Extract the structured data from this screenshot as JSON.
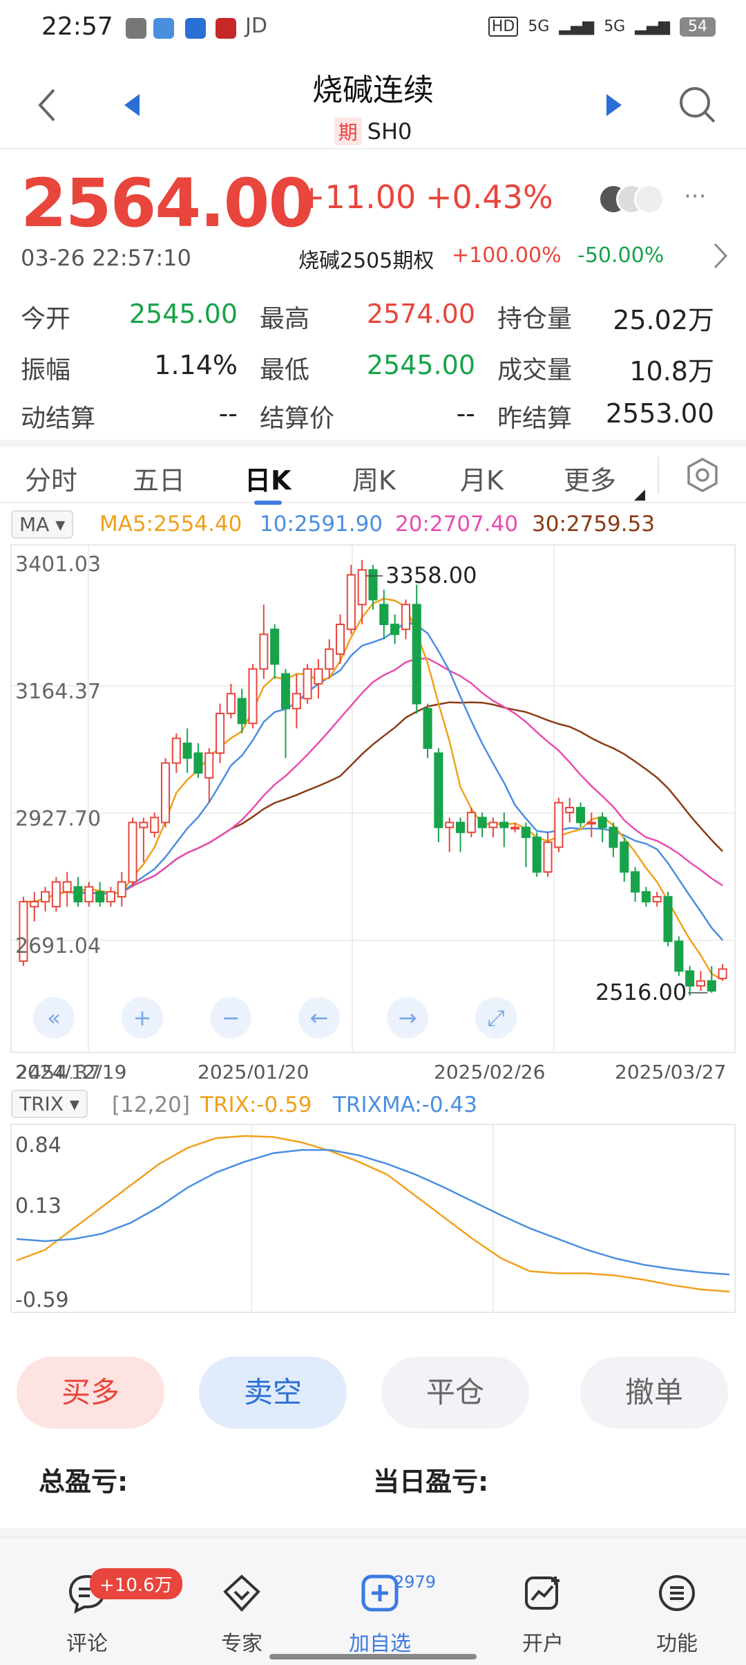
{
  "status_bar": {
    "time": "22:57",
    "carrier": "JD",
    "battery": "54",
    "net1": "5G",
    "net2": "5G",
    "hd": "HD"
  },
  "header": {
    "title": "烧碱连续",
    "badge": "期",
    "code": "SH0"
  },
  "quote": {
    "price": "2564.00",
    "change": "+11.00",
    "change_pct": "+0.43%",
    "datetime": "03-26 22:57:10",
    "option_name": "烧碱2505期权",
    "option_up": "+100.00%",
    "option_down": "-50.00%"
  },
  "stats": {
    "open_label": "今开",
    "open": "2545.00",
    "high_label": "最高",
    "high": "2574.00",
    "oi_label": "持仓量",
    "oi": "25.02万",
    "amp_label": "振幅",
    "amp": "1.14%",
    "low_label": "最低",
    "low": "2545.00",
    "vol_label": "成交量",
    "vol": "10.8万",
    "settle_dyn_label": "动结算",
    "settle_dyn": "--",
    "settle_label": "结算价",
    "settle": "--",
    "prev_settle_label": "昨结算",
    "prev_settle": "2553.00"
  },
  "tabs": [
    "分时",
    "五日",
    "日K",
    "周K",
    "月K",
    "更多"
  ],
  "ma_legend": {
    "selector": "MA",
    "ma5": "MA5:2554.40",
    "ma10": "10:2591.90",
    "ma20": "20:2707.40",
    "ma30": "30:2759.53"
  },
  "trix_legend": {
    "selector": "TRIX",
    "params": "[12,20]",
    "trix": "TRIX:-0.59",
    "trixma": "TRIXMA:-0.43"
  },
  "colors": {
    "up": "#e8453c",
    "down": "#17a34a",
    "ma5": "#f0a01c",
    "ma10": "#4a8ee0",
    "ma20": "#e84cb0",
    "ma30": "#8b3a14"
  },
  "chart_data": [
    {
      "type": "candlestick",
      "y_ticks": [
        "3401.03",
        "3164.37",
        "2927.70",
        "2691.04",
        "2454.37"
      ],
      "ylim": [
        2454.37,
        3401.03
      ],
      "x_ticks": [
        "2024/12/19",
        "2025/01/20",
        "2025/02/26",
        "2025/03/27"
      ],
      "annotations": {
        "high": "3358.00",
        "low": "2516.00"
      },
      "candles": [
        [
          2580,
          2700,
          2570,
          2710
        ],
        [
          2690,
          2700,
          2660,
          2720
        ],
        [
          2700,
          2720,
          2680,
          2730
        ],
        [
          2690,
          2740,
          2680,
          2750
        ],
        [
          2720,
          2740,
          2690,
          2760
        ],
        [
          2730,
          2700,
          2690,
          2750
        ],
        [
          2700,
          2730,
          2690,
          2740
        ],
        [
          2720,
          2700,
          2690,
          2740
        ],
        [
          2700,
          2720,
          2690,
          2730
        ],
        [
          2710,
          2740,
          2690,
          2760
        ],
        [
          2740,
          2860,
          2730,
          2870
        ],
        [
          2850,
          2860,
          2780,
          2870
        ],
        [
          2840,
          2870,
          2830,
          2880
        ],
        [
          2860,
          2980,
          2850,
          2990
        ],
        [
          2980,
          3030,
          2960,
          3040
        ],
        [
          3020,
          2990,
          2960,
          3050
        ],
        [
          3000,
          2960,
          2950,
          3020
        ],
        [
          2950,
          3000,
          2900,
          3010
        ],
        [
          3000,
          3080,
          2980,
          3100
        ],
        [
          3080,
          3120,
          3070,
          3140
        ],
        [
          3110,
          3060,
          3040,
          3130
        ],
        [
          3060,
          3170,
          3050,
          3180
        ],
        [
          3170,
          3240,
          3150,
          3300
        ],
        [
          3250,
          3180,
          3150,
          3260
        ],
        [
          3160,
          3090,
          2990,
          3170
        ],
        [
          3090,
          3120,
          3050,
          3160
        ],
        [
          3110,
          3170,
          3100,
          3180
        ],
        [
          3140,
          3170,
          3110,
          3190
        ],
        [
          3170,
          3210,
          3150,
          3230
        ],
        [
          3200,
          3260,
          3180,
          3280
        ],
        [
          3250,
          3360,
          3240,
          3380
        ],
        [
          3300,
          3370,
          3260,
          3390
        ],
        [
          3370,
          3310,
          3290,
          3380
        ],
        [
          3300,
          3260,
          3230,
          3330
        ],
        [
          3260,
          3240,
          3220,
          3280
        ],
        [
          3250,
          3300,
          3230,
          3310
        ],
        [
          3300,
          3100,
          3080,
          3340
        ],
        [
          3090,
          3010,
          2990,
          3100
        ],
        [
          3000,
          2850,
          2820,
          3010
        ],
        [
          2850,
          2860,
          2800,
          2870
        ],
        [
          2860,
          2840,
          2800,
          2870
        ],
        [
          2840,
          2880,
          2830,
          2890
        ],
        [
          2870,
          2850,
          2830,
          2880
        ],
        [
          2850,
          2860,
          2830,
          2870
        ],
        [
          2860,
          2850,
          2810,
          2880
        ],
        [
          2850,
          2850,
          2840,
          2860
        ],
        [
          2850,
          2830,
          2770,
          2860
        ],
        [
          2830,
          2760,
          2750,
          2840
        ],
        [
          2760,
          2820,
          2750,
          2840
        ],
        [
          2810,
          2900,
          2800,
          2910
        ],
        [
          2880,
          2890,
          2860,
          2910
        ],
        [
          2890,
          2860,
          2850,
          2900
        ],
        [
          2860,
          2860,
          2830,
          2880
        ],
        [
          2870,
          2850,
          2820,
          2880
        ],
        [
          2850,
          2810,
          2790,
          2860
        ],
        [
          2820,
          2760,
          2740,
          2830
        ],
        [
          2760,
          2720,
          2700,
          2770
        ],
        [
          2720,
          2700,
          2690,
          2730
        ],
        [
          2700,
          2710,
          2690,
          2720
        ],
        [
          2710,
          2620,
          2610,
          2720
        ],
        [
          2620,
          2560,
          2550,
          2630
        ],
        [
          2560,
          2530,
          2510,
          2570
        ],
        [
          2530,
          2540,
          2520,
          2560
        ],
        [
          2540,
          2520,
          2516,
          2570
        ],
        [
          2545,
          2564,
          2540,
          2574
        ]
      ],
      "ma5_end": "2554.40",
      "ma10_end": "2591.90",
      "ma20_end": "2707.40",
      "ma30_end": "2759.53"
    },
    {
      "type": "line",
      "y_ticks": [
        "0.84",
        "0.13",
        "-0.59"
      ],
      "ylim": [
        -0.59,
        0.84
      ],
      "series": [
        {
          "name": "TRIX",
          "values": [
            -0.3,
            -0.2,
            0.0,
            0.2,
            0.4,
            0.6,
            0.75,
            0.84,
            0.86,
            0.85,
            0.8,
            0.72,
            0.62,
            0.5,
            0.3,
            0.1,
            -0.1,
            -0.28,
            -0.4,
            -0.42,
            -0.42,
            -0.44,
            -0.48,
            -0.53,
            -0.57,
            -0.59
          ]
        },
        {
          "name": "TRIXMA",
          "values": [
            -0.1,
            -0.12,
            -0.1,
            -0.05,
            0.05,
            0.2,
            0.38,
            0.52,
            0.62,
            0.7,
            0.73,
            0.73,
            0.68,
            0.6,
            0.5,
            0.38,
            0.25,
            0.12,
            0.0,
            -0.1,
            -0.2,
            -0.28,
            -0.34,
            -0.38,
            -0.41,
            -0.43
          ]
        }
      ]
    }
  ],
  "actions": {
    "buy": "买多",
    "sell": "卖空",
    "close": "平仓",
    "cancel": "撤单"
  },
  "pnl": {
    "total_label": "总盈亏:",
    "day_label": "当日盈亏:"
  },
  "nav": {
    "comment": "评论",
    "expert": "专家",
    "add": "加自选",
    "account": "开户",
    "func": "功能",
    "comment_badge": "+10.6万",
    "add_count": "2979"
  }
}
